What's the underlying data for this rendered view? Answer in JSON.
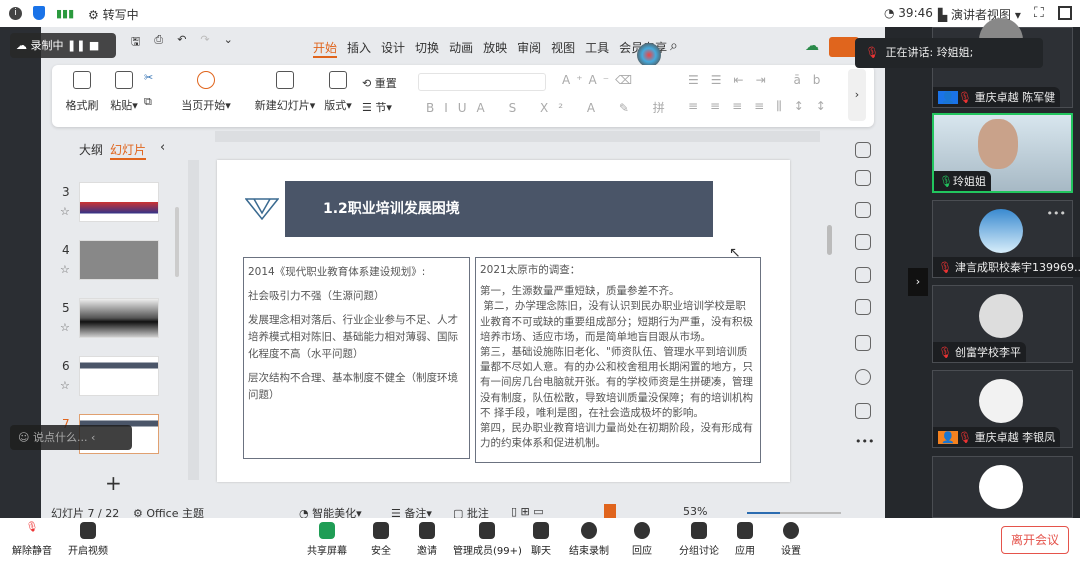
{
  "topbar": {
    "transcribing": "转写中",
    "timer": "39:46",
    "view_mode": "演讲者视图"
  },
  "recording": {
    "label": "录制中"
  },
  "wps": {
    "tabs": [
      "开始",
      "插入",
      "设计",
      "切换",
      "动画",
      "放映",
      "审阅",
      "视图",
      "工具",
      "会员专享"
    ],
    "active_tab": "开始",
    "ribbon": {
      "format_painter": "格式刷",
      "paste": "粘贴",
      "start_from_current": "当页开始",
      "new_slide": "新建幻灯片",
      "layout": "版式",
      "reset": "重置",
      "section": "节"
    },
    "pane_tabs": {
      "outline": "大纲",
      "slides": "幻灯片"
    },
    "slides": [
      "3",
      "4",
      "5",
      "6",
      "7"
    ],
    "current_slide": "7",
    "status": {
      "slide_count": "幻灯片 7 / 22",
      "theme": "Office 主题",
      "beautify": "智能美化",
      "notes": "备注",
      "comments": "批注",
      "zoom": "53%"
    }
  },
  "slide": {
    "title": "1.2职业培训发展困境",
    "left_box": [
      "2014《现代职业教育体系建设规划》:",
      "社会吸引力不强（生源问题）",
      "发展理念相对落后、行业企业参与不足、人才培养模式相对陈旧、基础能力相对薄弱、国际化程度不高（水平问题）",
      "层次结构不合理、基本制度不健全（制度环境问题）"
    ],
    "right_box": {
      "heading": "2021太原市的调查：",
      "body": "第一，生源数量严重短缺，质量参差不齐。\n 第二，办学理念陈旧，没有认识到民办职业培训学校是职业教育不可或缺的重要组成部分；短期行为严重，没有积极培养市场、适应市场，而是简单地盲目跟从市场。\n第三，基础设施陈旧老化、\"师资队伍、管理水平到培训质量都不尽如人意。有的办公和校舍租用长期闲置的地方，只有一间房几台电脑就开张。有的学校师资是生拼硬凑，管理没有制度，队伍松散，导致培训质量没保障；有的培训机构不 择手段，唯利是图，在社会造成极坏的影响。\n第四，民办职业教育培训力量尚处在初期阶段，没有形成有力的约束体系和促进机制。"
    }
  },
  "chat": {
    "placeholder": "说点什么..."
  },
  "speaking": {
    "label": "正在讲话:",
    "name": "玲姐姐;"
  },
  "participants": [
    "重庆卓越 陈军健",
    "玲姐姐",
    "津言成职校秦宇139969...",
    "创富学校李平",
    "重庆卓越 李银凤"
  ],
  "bottombar": {
    "unmute": "解除静音",
    "start_video": "开启视频",
    "share": "共享屏幕",
    "security": "安全",
    "invite": "邀请",
    "manage": "管理成员(99+)",
    "chat": "聊天",
    "end_record": "结束录制",
    "react": "回应",
    "breakout": "分组讨论",
    "apps": "应用",
    "settings": "设置",
    "leave": "离开会议"
  },
  "colors": {
    "accent": "#e0651d",
    "slide_header": "#4a5568",
    "leave": "#e5534b",
    "active_speaker": "#22c55e"
  }
}
